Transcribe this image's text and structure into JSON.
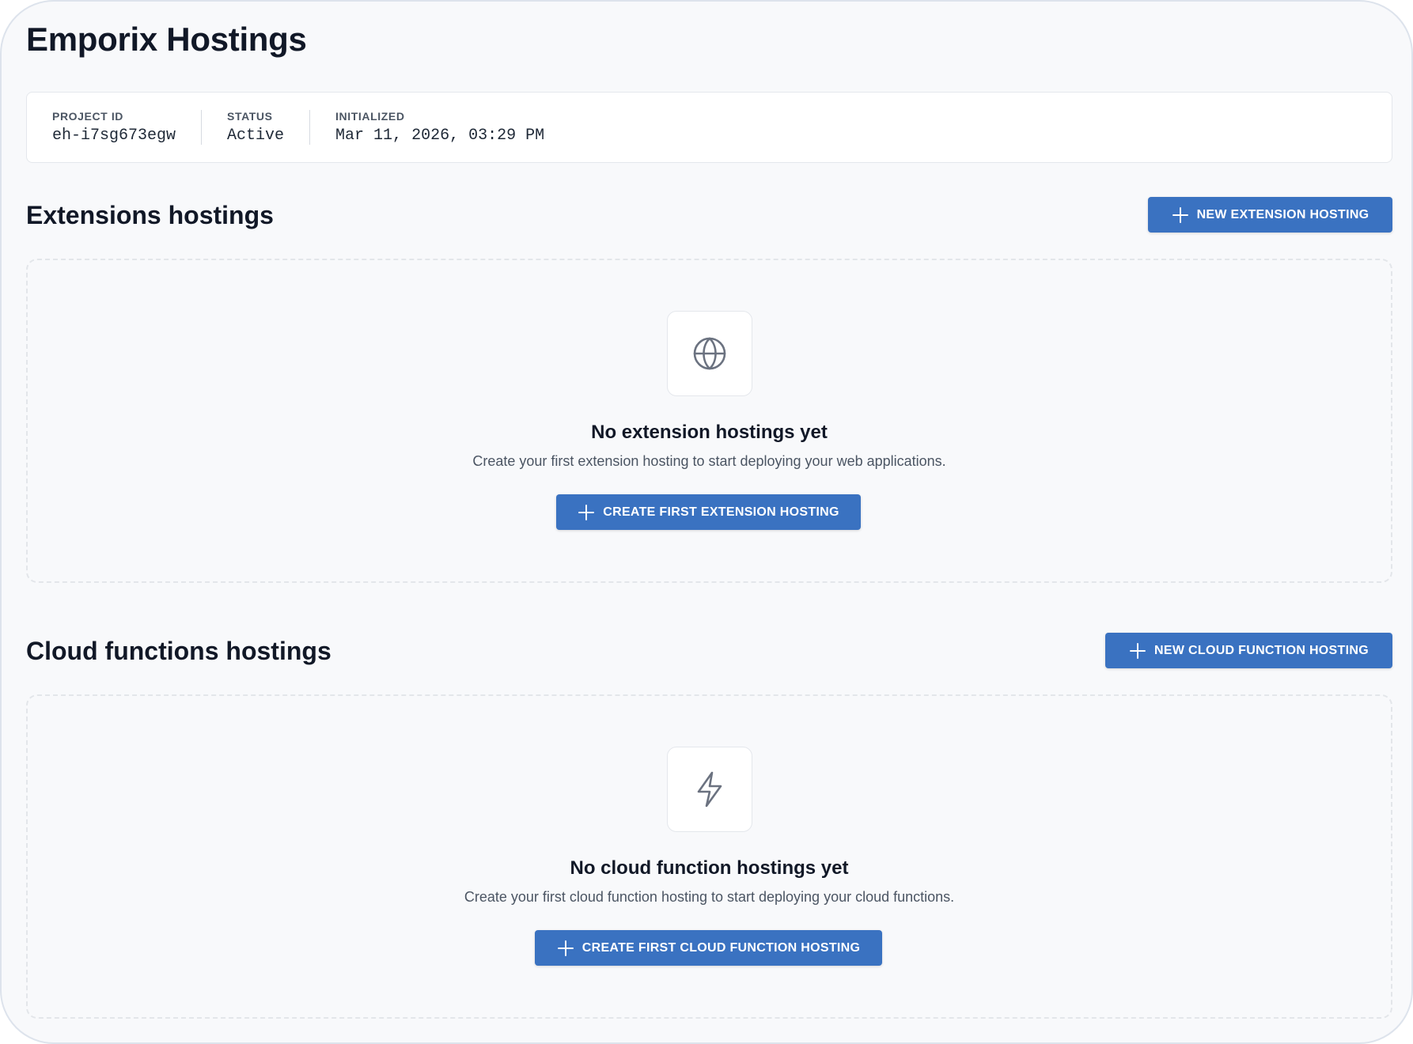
{
  "page": {
    "title": "Emporix Hostings"
  },
  "project_info": {
    "project_id_label": "PROJECT ID",
    "project_id_value": "eh-i7sg673egw",
    "status_label": "STATUS",
    "status_value": "Active",
    "initialized_label": "INITIALIZED",
    "initialized_value": "Mar 11, 2026, 03:29 PM"
  },
  "extensions": {
    "title": "Extensions hostings",
    "new_button_label": "NEW EXTENSION HOSTING",
    "empty_icon": "globe-icon",
    "empty_title": "No extension hostings yet",
    "empty_description": "Create your first extension hosting to start deploying your web applications.",
    "create_button_label": "CREATE FIRST EXTENSION HOSTING"
  },
  "cloud_functions": {
    "title": "Cloud functions hostings",
    "new_button_label": "NEW CLOUD FUNCTION HOSTING",
    "empty_icon": "lightning-icon",
    "empty_title": "No cloud function hostings yet",
    "empty_description": "Create your first cloud function hosting to start deploying your cloud functions.",
    "create_button_label": "CREATE FIRST CLOUD FUNCTION HOSTING"
  },
  "colors": {
    "primary_button": "#3a72c1",
    "page_background": "#f8f9fb",
    "title_text": "#111827",
    "muted_text": "#4b5563",
    "icon_stroke": "#6b7280"
  }
}
